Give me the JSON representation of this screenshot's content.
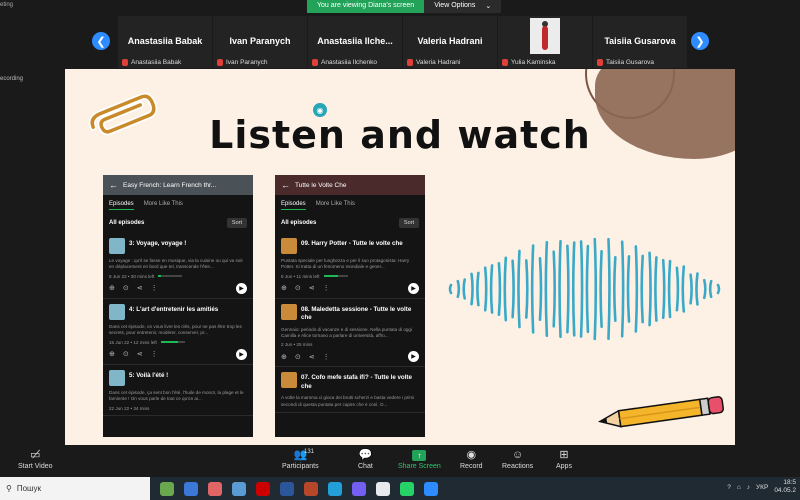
{
  "banner": {
    "viewing_text": "You are viewing Diana's screen",
    "options_label": "View Options",
    "options_chevron": "⌄"
  },
  "window_corner_text": "eting",
  "recording_text": "ecording",
  "participants": {
    "prev_arrow": "❮",
    "next_arrow": "❯",
    "tiles": [
      {
        "big": "Anastasiia Babak",
        "small": "Anastasiia Babak"
      },
      {
        "big": "Ivan Paranych",
        "small": "Ivan Paranych"
      },
      {
        "big": "Anastasiia Ilche...",
        "small": "Anastasiia Ilchenko"
      },
      {
        "big": "Valeria Hadrani",
        "small": "Valeria Hadrani"
      },
      {
        "big": "",
        "small": "Yulia Kaminska"
      },
      {
        "big": "Taisiia Gusarova",
        "small": "Taisiia Gusarova"
      }
    ]
  },
  "slide": {
    "title": "Listen and watch",
    "phone1": {
      "header": "Easy French: Learn French thr...",
      "tab_episodes": "Episodes",
      "tab_more": "More Like This",
      "all_episodes": "All episodes",
      "sort": "Sort",
      "episodes": [
        {
          "title": "3: Voyage, voyage !",
          "desc": "Le voyage : qu'il se fasse en musique, via la cuisine ou qui va soit en déplacement en bord que tel, transcende l'être...",
          "meta": "8 Jun 22 • 30 mins left",
          "progress": 0.1
        },
        {
          "title": "4: L'art d'entretenir les amitiés",
          "desc": "Dans cet épisode, on vous livre les clés, pour ne pas être trop les secrets, pour entretenir, modérer, conserver, pr...",
          "meta": "15 Jun 22 • 12 mins left",
          "progress": 0.7
        },
        {
          "title": "5: Voilà l'été !",
          "desc": "Dans cet épisode, ça sent bon l'été, l'huile de monoï, la plage et le farniente ! On vous parle de tout ce qu'on ai...",
          "meta": "22 Jun 22 • 34 mins",
          "progress": 0
        }
      ]
    },
    "phone2": {
      "header": "Tutte le Volte Che",
      "tab_episodes": "Episodes",
      "tab_more": "More Like This",
      "all_episodes": "All episodes",
      "sort": "Sort",
      "episodes": [
        {
          "title": "09. Harry Potter - Tutte le volte che",
          "desc": "Puntata speciale per lunghezza e per il suo protagonista: Harry Potter. Si tratta di un fenomeno mondiale e gener...",
          "meta": "9 Jun • 11 mins left",
          "progress": 0.6
        },
        {
          "title": "08. Maledetta sessione - Tutte le volte che",
          "desc": "Gennaio: periodo di vacanze e di sessione. Nella puntata di oggi Camilla e Alice tornano a parlare di università, affro...",
          "meta": "2 Jun • 25 mins",
          "progress": 0
        },
        {
          "title": "07. Cofo mefe stafa ifi? - Tutte le volte che",
          "desc": "A volte la mamma ci gioca dei brutti scherzi e basta vedere i primi secondi di questa puntata per capire che è così. O...",
          "meta": "",
          "progress": 0
        }
      ]
    }
  },
  "toolbar": {
    "start_video": "Start Video",
    "participants": "Participants",
    "participants_count": "131",
    "chat": "Chat",
    "share_screen": "Share Screen",
    "record": "Record",
    "reactions": "Reactions",
    "apps": "Apps"
  },
  "taskbar": {
    "search_placeholder": "Пошук",
    "lang": "УКР",
    "time": "18:5",
    "date": "04.05.2"
  },
  "colors": {
    "zoom_blue": "#2d8cff",
    "zoom_green": "#23a35a",
    "slide_bg": "#fdf1e6",
    "wave": "#3aa9c8"
  }
}
